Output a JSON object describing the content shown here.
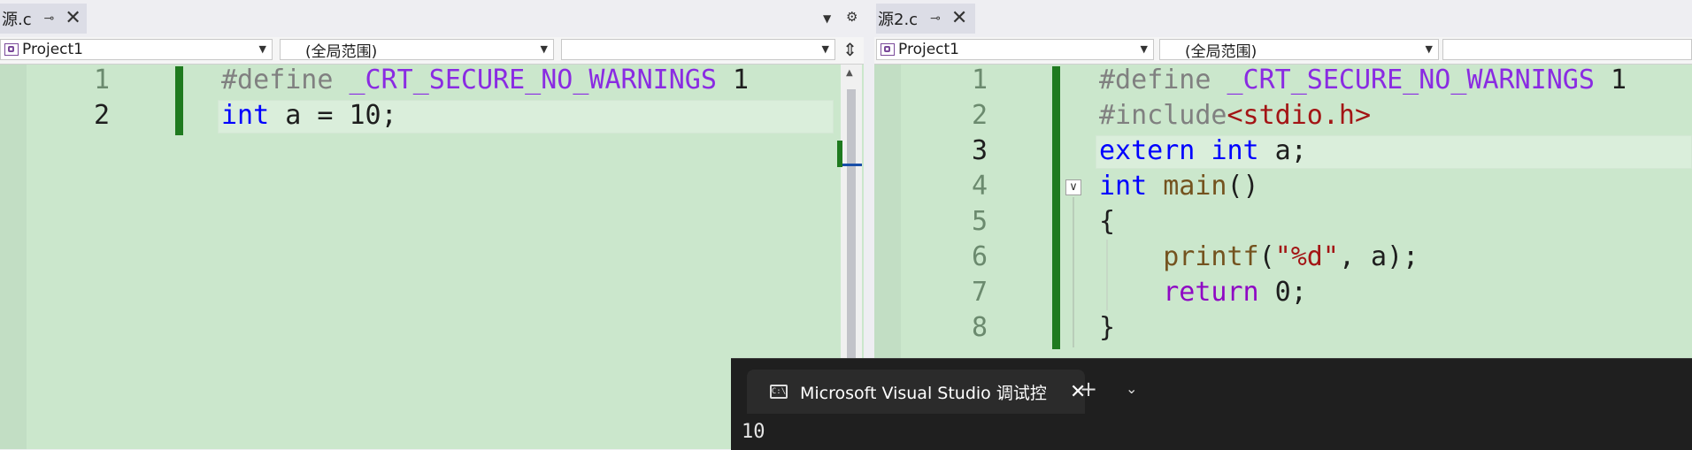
{
  "left": {
    "tab": {
      "title": "源.c",
      "pin_icon": "pin-icon",
      "close_icon": "close-icon"
    },
    "tools": {
      "dropdown_icon": "chevron-down-icon",
      "settings_icon": "gear-icon"
    },
    "nav": {
      "project": "Project1",
      "scope": "(全局范围)",
      "member": "",
      "split_icon": "split-icon"
    },
    "lines": [
      {
        "num": "1",
        "tokens": [
          {
            "t": "#define ",
            "c": "pre"
          },
          {
            "t": "_CRT_SECURE_NO_WARNINGS",
            "c": "macro"
          },
          {
            "t": " 1",
            "c": "id"
          }
        ]
      },
      {
        "num": "2",
        "tokens": [
          {
            "t": "int",
            "c": "kw"
          },
          {
            "t": " a = 10;",
            "c": "id"
          }
        ]
      }
    ]
  },
  "right": {
    "tab": {
      "title": "源2.c",
      "pin_icon": "pin-icon",
      "close_icon": "close-icon"
    },
    "nav": {
      "project": "Project1",
      "scope": "(全局范围)",
      "member": ""
    },
    "lines": [
      {
        "num": "1",
        "tokens": [
          {
            "t": "#define ",
            "c": "pre"
          },
          {
            "t": "_CRT_SECURE_NO_WARNINGS",
            "c": "macro"
          },
          {
            "t": " 1",
            "c": "id"
          }
        ]
      },
      {
        "num": "2",
        "tokens": [
          {
            "t": "#include",
            "c": "pre"
          },
          {
            "t": "<stdio.h>",
            "c": "str"
          }
        ]
      },
      {
        "num": "3",
        "tokens": [
          {
            "t": "extern",
            "c": "kw"
          },
          {
            "t": " ",
            "c": "id"
          },
          {
            "t": "int",
            "c": "kw"
          },
          {
            "t": " a;",
            "c": "id"
          }
        ]
      },
      {
        "num": "4",
        "tokens": [
          {
            "t": "int",
            "c": "kw"
          },
          {
            "t": " ",
            "c": "id"
          },
          {
            "t": "main",
            "c": "fn"
          },
          {
            "t": "()",
            "c": "id"
          }
        ]
      },
      {
        "num": "5",
        "tokens": [
          {
            "t": "{",
            "c": "id"
          }
        ]
      },
      {
        "num": "6",
        "tokens": [
          {
            "t": "    ",
            "c": "id"
          },
          {
            "t": "printf",
            "c": "fn"
          },
          {
            "t": "(",
            "c": "id"
          },
          {
            "t": "\"%d\"",
            "c": "str"
          },
          {
            "t": ", a);",
            "c": "id"
          }
        ]
      },
      {
        "num": "7",
        "tokens": [
          {
            "t": "    ",
            "c": "id"
          },
          {
            "t": "return",
            "c": "ctl"
          },
          {
            "t": " 0;",
            "c": "id"
          }
        ]
      },
      {
        "num": "8",
        "tokens": [
          {
            "t": "}",
            "c": "id"
          }
        ]
      }
    ]
  },
  "console": {
    "tab_title": "Microsoft Visual Studio 调试控",
    "icon": "console-icon",
    "close_icon": "close-icon",
    "new_tab_icon": "plus-icon",
    "dropdown_icon": "chevron-down-icon",
    "output": "10"
  },
  "colors": {
    "editor_bg": "#cbe7cc",
    "changed_bar": "#1f7a1f",
    "keyword": "#0000ff",
    "macro": "#8a2be2",
    "string": "#a31515",
    "function": "#74531f"
  }
}
